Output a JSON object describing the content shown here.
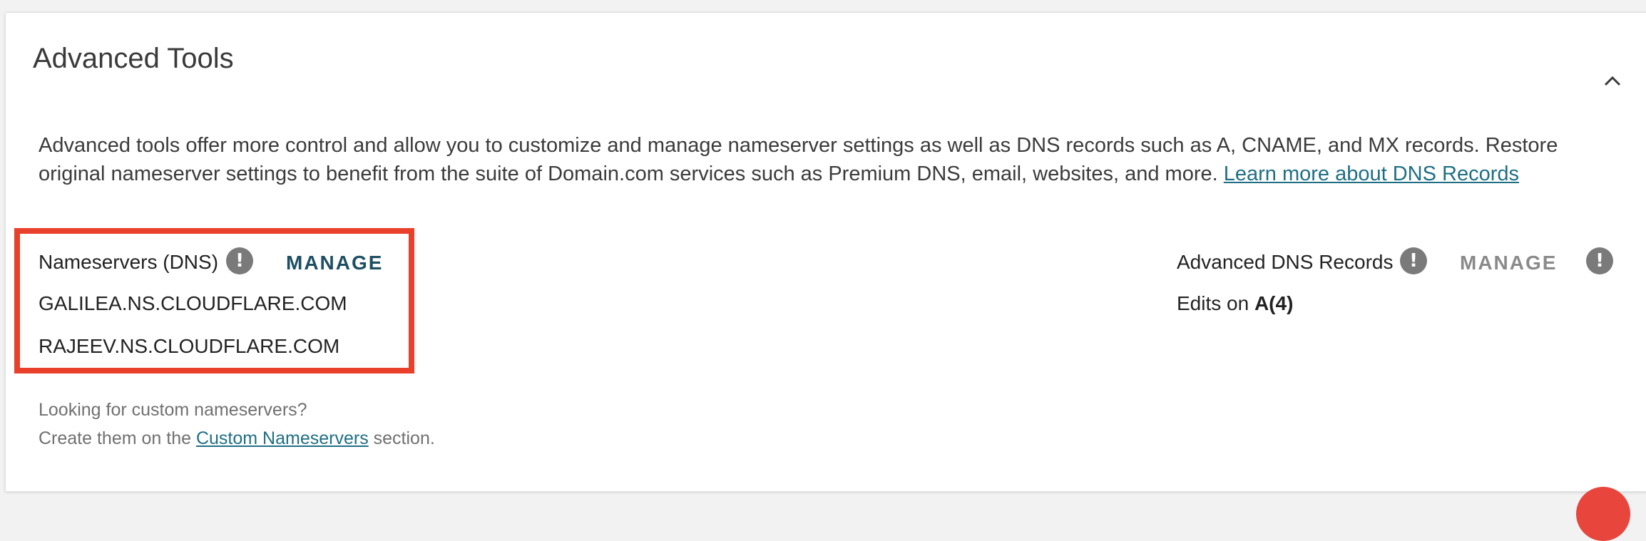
{
  "panel": {
    "title": "Advanced Tools",
    "description": "Advanced tools offer more control and allow you to customize and manage nameserver settings as well as DNS records such as A, CNAME, and MX records. Restore original nameserver settings to benefit from the suite of Domain.com services such as Premium DNS, email, websites, and more.",
    "learn_more_link": "Learn more about DNS Records",
    "collapse_icon": "chevron-up-icon"
  },
  "nameservers": {
    "label": "Nameservers (DNS)",
    "info_icon": "!",
    "manage_label": "MANAGE",
    "values": [
      "GALILEA.NS.CLOUDFLARE.COM",
      "RAJEEV.NS.CLOUDFLARE.COM"
    ],
    "highlight_color": "#e8402a"
  },
  "custom_nameservers": {
    "line1": "Looking for custom nameservers?",
    "line2_prefix": "Create them on the",
    "link": "Custom Nameservers",
    "line2_suffix": "section."
  },
  "advanced_dns": {
    "label": "Advanced DNS Records",
    "info_icon": "!",
    "manage_label": "MANAGE",
    "warning_icon": "!",
    "edits_prefix": "Edits on",
    "edits_value": "A(4)"
  },
  "colors": {
    "accent": "#1d4f63",
    "link": "#1f6f84",
    "fab": "#e8453c"
  }
}
